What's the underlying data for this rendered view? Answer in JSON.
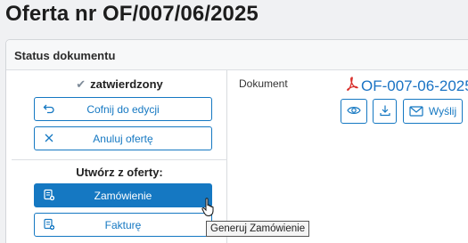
{
  "page": {
    "title": "Oferta nr OF/007/06/2025"
  },
  "panel": {
    "header": "Status dokumentu",
    "status": {
      "icon": "check-icon",
      "text": "zatwierdzony"
    },
    "actions": {
      "undo_label": "Cofnij do edycji",
      "cancel_label": "Anuluj ofertę"
    },
    "create": {
      "heading": "Utwórz z oferty:",
      "order_label": "Zamówienie",
      "invoice_label": "Fakturę"
    },
    "document": {
      "label": "Dokument",
      "file_name": "OF-007-06-2025",
      "send_label": "Wyślij"
    }
  },
  "tooltip": {
    "text": "Generuj Zamówienie"
  },
  "colors": {
    "accent": "#1578c2",
    "pdf_icon": "#d9302c"
  }
}
